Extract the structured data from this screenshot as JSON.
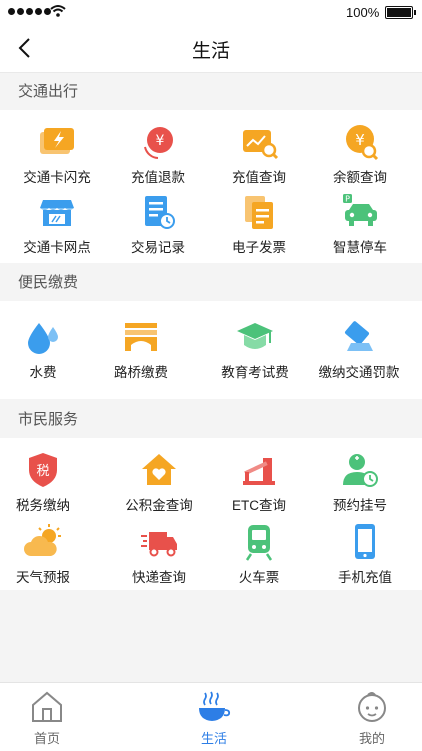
{
  "status_bar": {
    "battery": "100%"
  },
  "header": {
    "title": "生活"
  },
  "sections": [
    {
      "title": "交通出行",
      "items": [
        {
          "label": "交通卡闪充",
          "icon": "lightning-card-icon"
        },
        {
          "label": "充值退款",
          "icon": "yen-refund-icon"
        },
        {
          "label": "充值查询",
          "icon": "recharge-search-icon"
        },
        {
          "label": "余额查询",
          "icon": "balance-search-icon"
        },
        {
          "label": "交通卡网点",
          "icon": "card-outlet-icon"
        },
        {
          "label": "交易记录",
          "icon": "transaction-record-icon"
        },
        {
          "label": "电子发票",
          "icon": "e-invoice-icon"
        },
        {
          "label": "智慧停车",
          "icon": "smart-parking-icon"
        }
      ]
    },
    {
      "title": "便民缴费",
      "items": [
        {
          "label": "水费",
          "icon": "water-drop-icon"
        },
        {
          "label": "路桥缴费",
          "icon": "bridge-icon"
        },
        {
          "label": "教育考试费",
          "icon": "graduation-cap-icon"
        },
        {
          "label": "缴纳交通罚款",
          "icon": "traffic-fine-icon"
        }
      ]
    },
    {
      "title": "市民服务",
      "items": [
        {
          "label": "税务缴纳",
          "icon": "tax-shield-icon",
          "badge": "税"
        },
        {
          "label": "公积金查询",
          "icon": "housing-fund-icon"
        },
        {
          "label": "ETC查询",
          "icon": "etc-gate-icon"
        },
        {
          "label": "预约挂号",
          "icon": "doctor-appointment-icon"
        },
        {
          "label": "天气预报",
          "icon": "weather-icon"
        },
        {
          "label": "快递查询",
          "icon": "delivery-truck-icon"
        },
        {
          "label": "火车票",
          "icon": "train-icon"
        },
        {
          "label": "手机充值",
          "icon": "phone-recharge-icon"
        }
      ]
    }
  ],
  "tab_bar": {
    "active": 1,
    "tabs": [
      {
        "label": "首页",
        "icon": "home-icon"
      },
      {
        "label": "生活",
        "icon": "life-bowl-icon"
      },
      {
        "label": "我的",
        "icon": "profile-face-icon"
      }
    ]
  },
  "colors": {
    "accent": "#2d7ee6",
    "orange": "#f5a623",
    "red": "#e8514b",
    "green": "#4cc27a",
    "blue": "#3b9ded"
  }
}
